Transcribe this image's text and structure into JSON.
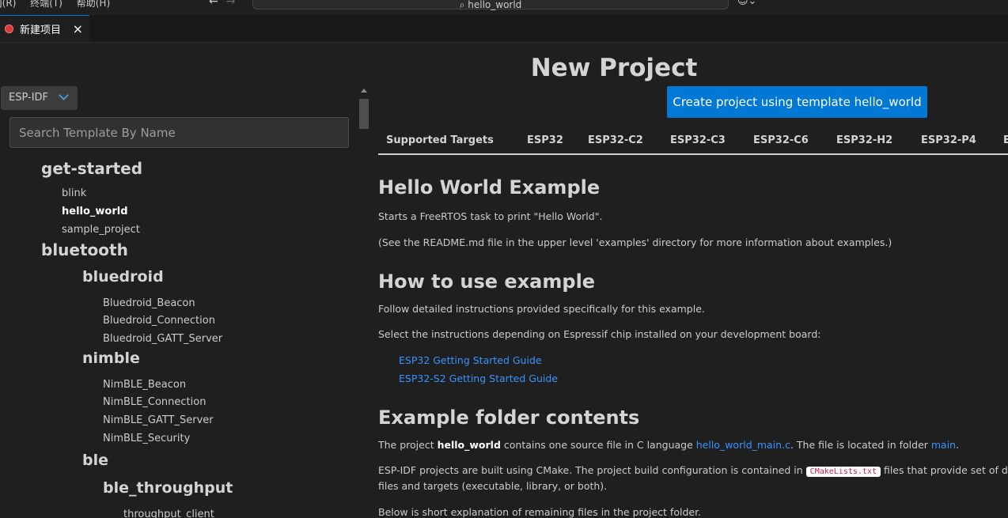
{
  "menu": {
    "items": [
      "](R)",
      "终端(T)",
      "帮助(H)"
    ]
  },
  "command_center": {
    "text": "hello_world"
  },
  "tab": {
    "label": "新建项目",
    "close": "×"
  },
  "sidebar": {
    "framework": "ESP-IDF",
    "search_placeholder": "Search Template By Name",
    "tree": {
      "get_started": "get-started",
      "blink": "blink",
      "hello_world": "hello_world",
      "sample_project": "sample_project",
      "bluetooth": "bluetooth",
      "bluedroid": "bluedroid",
      "bluedroid_beacon": "Bluedroid_Beacon",
      "bluedroid_connection": "Bluedroid_Connection",
      "bluedroid_gatt_server": "Bluedroid_GATT_Server",
      "nimble": "nimble",
      "nimble_beacon": "NimBLE_Beacon",
      "nimble_connection": "NimBLE_Connection",
      "nimble_gatt_server": "NimBLE_GATT_Server",
      "nimble_security": "NimBLE_Security",
      "ble": "ble",
      "ble_throughput": "ble_throughput",
      "throughput_client": "throughput_client"
    }
  },
  "main": {
    "title": "New Project",
    "create_button": "Create project using template hello_world",
    "targets": [
      "Supported Targets",
      "ESP32",
      "ESP32-C2",
      "ESP32-C3",
      "ESP32-C6",
      "ESP32-H2",
      "ESP32-P4",
      "E"
    ],
    "readme": {
      "h1": "Hello World Example",
      "p1": "Starts a FreeRTOS task to print \"Hello World\".",
      "p2": "(See the README.md file in the upper level 'examples' directory for more information about examples.)",
      "h2": "How to use example",
      "p3": "Follow detailed instructions provided specifically for this example.",
      "p4": "Select the instructions depending on Espressif chip installed on your development board:",
      "guide1": "ESP32 Getting Started Guide",
      "guide2": "ESP32-S2 Getting Started Guide",
      "h3": "Example folder contents",
      "p5_a": "The project ",
      "p5_b": "hello_world",
      "p5_c": " contains one source file in C language ",
      "p5_link1": "hello_world_main.c",
      "p5_d": ". The file is located in folder ",
      "p5_link2": "main",
      "p5_e": ".",
      "p6_a": "ESP-IDF projects are built using CMake. The project build configuration is contained in ",
      "p6_code": "CMakeLists.txt",
      "p6_b": " files that provide set of directives ar",
      "p6_line2": "files and targets (executable, library, or both).",
      "p7": "Below is short explanation of remaining files in the project folder."
    }
  },
  "colors": {
    "accent": "#0078d4",
    "link": "#3794ff",
    "background": "#1f1f1f"
  }
}
